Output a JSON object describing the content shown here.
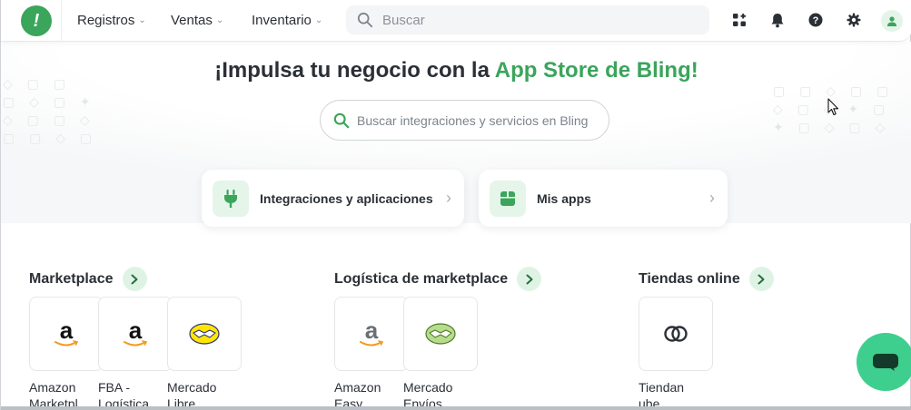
{
  "nav": {
    "items": [
      {
        "label": "Registros"
      },
      {
        "label": "Ventas"
      },
      {
        "label": "Inventario"
      }
    ],
    "search_placeholder": "Buscar"
  },
  "hero": {
    "title_prefix": "¡Impulsa tu negocio con la ",
    "title_highlight": "App Store de Bling",
    "title_suffix": "!",
    "search_placeholder": "Buscar integraciones y servicios en Bling"
  },
  "categories": [
    {
      "label": "Integraciones y aplicaciones",
      "icon": "plug-icon"
    },
    {
      "label": "Mis apps",
      "icon": "box-icon"
    }
  ],
  "sections": [
    {
      "title": "Marketplace",
      "apps": [
        {
          "name": "Amazon Marketpl",
          "icon": "amazon-logo"
        },
        {
          "name": "FBA - Logística",
          "icon": "amazon-logo"
        },
        {
          "name": "Mercado Libre",
          "icon": "mercadolibre-logo"
        }
      ]
    },
    {
      "title": "Logística de marketplace",
      "apps": [
        {
          "name": "Amazon Easy",
          "icon": "amazon-logo"
        },
        {
          "name": "Mercado Envíos",
          "icon": "mercadoenvios-logo"
        }
      ]
    },
    {
      "title": "Tiendas online",
      "apps": [
        {
          "name": "Tiendan ube",
          "icon": "tiendanube-logo"
        }
      ]
    }
  ],
  "colors": {
    "brand": "#3aa55b",
    "chat": "#3ecf8e",
    "arrow_bg": "#dff3e5"
  }
}
